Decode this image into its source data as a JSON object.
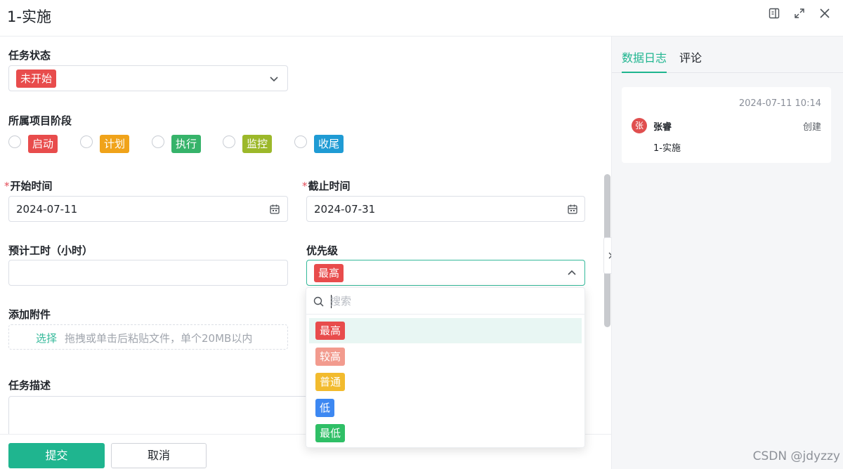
{
  "header": {
    "title": "1-实施"
  },
  "form": {
    "status": {
      "label": "任务状态",
      "value": "未开始",
      "color": "#e84c4c"
    },
    "phase": {
      "label": "所属项目阶段",
      "options": [
        {
          "label": "启动",
          "color": "#e84c4c"
        },
        {
          "label": "计划",
          "color": "#f0a31a"
        },
        {
          "label": "执行",
          "color": "#36b36a"
        },
        {
          "label": "监控",
          "color": "#9cb82a"
        },
        {
          "label": "收尾",
          "color": "#1f9bd4"
        }
      ]
    },
    "start": {
      "required_mark": "*",
      "label": "开始时间",
      "value": "2024-07-11"
    },
    "end": {
      "required_mark": "*",
      "label": "截止时间",
      "value": "2024-07-31"
    },
    "hours": {
      "label": "预计工时（小时）",
      "value": ""
    },
    "priority": {
      "label": "优先级",
      "value": "最高",
      "color": "#e84c4c"
    },
    "attachment": {
      "label": "添加附件",
      "select": "选择",
      "hint": "拖拽或单击后粘贴文件，单个20MB以内"
    },
    "description": {
      "label": "任务描述"
    }
  },
  "footer": {
    "submit": "提交",
    "cancel": "取消"
  },
  "dropdown": {
    "search_placeholder": "搜索",
    "options": [
      {
        "label": "最高",
        "color": "#e84c4c"
      },
      {
        "label": "较高",
        "color": "#f29b8e"
      },
      {
        "label": "普通",
        "color": "#f2bb2e"
      },
      {
        "label": "低",
        "color": "#3d88f2"
      },
      {
        "label": "最低",
        "color": "#2fbf66"
      }
    ]
  },
  "right_panel": {
    "tabs": [
      "数据日志",
      "评论"
    ],
    "log": {
      "time": "2024-07-11 10:14",
      "avatar": "张",
      "user": "张睿",
      "action": "创建",
      "target": "1-实施"
    }
  },
  "watermark": "CSDN @jdyzzy",
  "colors": {
    "accent": "#1fb58f"
  }
}
